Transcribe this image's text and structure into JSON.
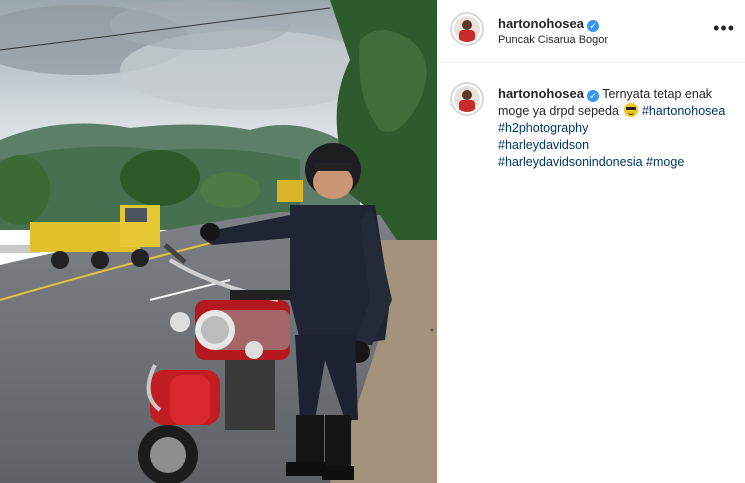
{
  "post": {
    "username": "hartonohosea",
    "location": "Puncak Cisarua Bogor",
    "more_label": "•••",
    "verified_glyph": "✓",
    "caption": {
      "text": "Ternyata tetap enak moge ya drpd sepeda",
      "emoji": "sunglasses-emoji",
      "hashtags": [
        "#hartonohosea",
        "#h2photography",
        "#harleydavidson",
        "#harleydavidsonindonesia",
        "#moge"
      ]
    }
  },
  "colors": {
    "link": "#00376b",
    "verified": "#3897f0",
    "text": "#262626"
  }
}
